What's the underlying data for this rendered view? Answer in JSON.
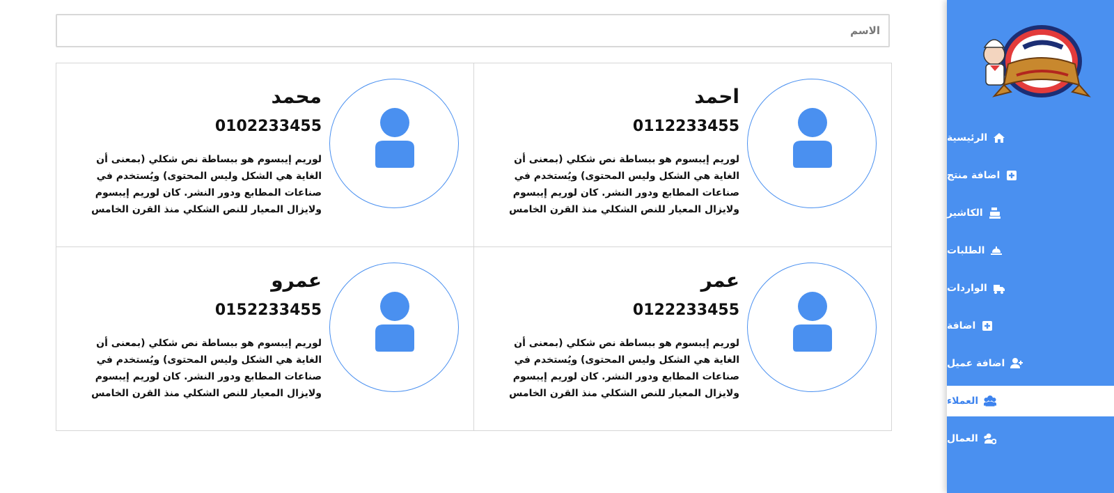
{
  "search": {
    "placeholder": "الاسم"
  },
  "sidebar": {
    "brand_color": "#4a90f0",
    "items": [
      {
        "label": "الرئيسية",
        "icon": "home-icon",
        "active": false
      },
      {
        "label": "اضافة منتج",
        "icon": "plus-square-icon",
        "active": false
      },
      {
        "label": "الكاشير",
        "icon": "cash-register-icon",
        "active": false
      },
      {
        "label": "الطلبات",
        "icon": "concierge-bell-icon",
        "active": false
      },
      {
        "label": "الواردات",
        "icon": "truck-loading-icon",
        "active": false
      },
      {
        "label": "اضافة",
        "icon": "plus-square-icon",
        "active": false
      },
      {
        "label": "اضافة عميل",
        "icon": "user-plus-icon",
        "active": false
      },
      {
        "label": "العملاء",
        "icon": "users-icon",
        "active": true
      },
      {
        "label": "العمال",
        "icon": "users-cog-icon",
        "active": false
      }
    ]
  },
  "customers": [
    {
      "name": "محمد",
      "phone": "0102233455",
      "description": "لوريم إيبسوم هو ببساطة نص شكلي (بمعنى أن الغاية هي الشكل وليس المحتوى) ويُستخدم في صناعات المطابع ودور النشر. كان لوريم إيبسوم ولايزال المعيار للنص الشكلي منذ القرن الخامس"
    },
    {
      "name": "احمد",
      "phone": "0112233455",
      "description": "لوريم إيبسوم هو ببساطة نص شكلي (بمعنى أن الغاية هي الشكل وليس المحتوى) ويُستخدم في صناعات المطابع ودور النشر. كان لوريم إيبسوم ولايزال المعيار للنص الشكلي منذ القرن الخامس"
    },
    {
      "name": "عمرو",
      "phone": "0152233455",
      "description": "لوريم إيبسوم هو ببساطة نص شكلي (بمعنى أن الغاية هي الشكل وليس المحتوى) ويُستخدم في صناعات المطابع ودور النشر. كان لوريم إيبسوم ولايزال المعيار للنص الشكلي منذ القرن الخامس"
    },
    {
      "name": "عمر",
      "phone": "0122233455",
      "description": "لوريم إيبسوم هو ببساطة نص شكلي (بمعنى أن الغاية هي الشكل وليس المحتوى) ويُستخدم في صناعات المطابع ودور النشر. كان لوريم إيبسوم ولايزال المعيار للنص الشكلي منذ القرن الخامس"
    }
  ]
}
